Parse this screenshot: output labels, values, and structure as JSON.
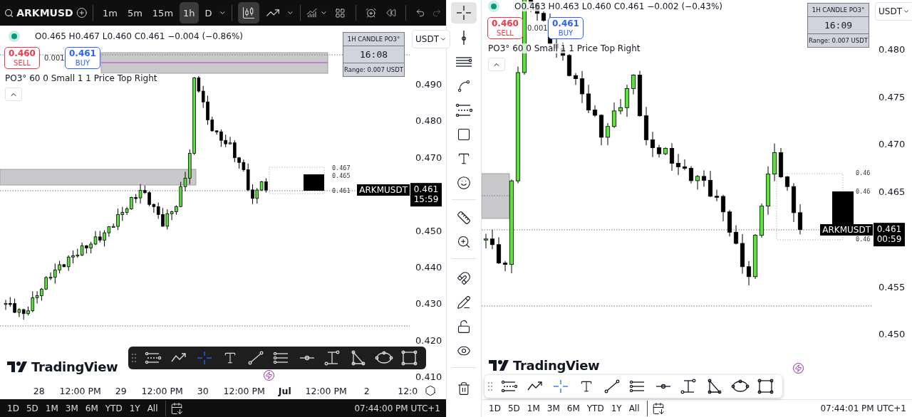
{
  "left": {
    "symbol": "ARKMUSD",
    "intervals": [
      {
        "label": "1m",
        "selected": false
      },
      {
        "label": "5m",
        "selected": false
      },
      {
        "label": "15m",
        "selected": false
      },
      {
        "label": "1h",
        "selected": true
      },
      {
        "label": "D",
        "selected": false
      }
    ],
    "chart_types": [
      {
        "kind": "candles",
        "selected": true
      },
      {
        "kind": "line",
        "selected": false
      }
    ],
    "legend": "O0.465 H0.467 L0.460 C0.461 −0.004 (−0.86%)",
    "sell": {
      "price": "0.460",
      "label": "SELL"
    },
    "spread": "0.001",
    "buy": {
      "price": "0.461",
      "label": "BUY"
    },
    "indicator": "PO3° 60 0 Small 1 1 Price Top Right",
    "candle_box": {
      "title": "1H CANDLE PO3°",
      "time": "16:08",
      "range": "Range: 0.007 USDT"
    },
    "currency": "USDT",
    "price_labels": [
      "0.490",
      "0.480",
      "0.470",
      "0.450",
      "0.440",
      "0.430",
      "0.420",
      "0.410"
    ],
    "level_labels": [
      "0.467",
      "0.465",
      "0.461"
    ],
    "last_price": {
      "symbol": "ARKMUSDT",
      "price": "0.461",
      "countdown": "15:59"
    },
    "logo": "TradingView",
    "tools": [
      {
        "kind": "fib-channel",
        "selected": false
      },
      {
        "kind": "path",
        "selected": false
      },
      {
        "kind": "crosshair",
        "selected": true
      },
      {
        "kind": "text",
        "selected": false
      },
      {
        "kind": "trend-line",
        "selected": false
      },
      {
        "kind": "parallel-channel",
        "selected": false
      },
      {
        "kind": "horizontal-ray",
        "selected": false
      },
      {
        "kind": "price-range",
        "selected": false
      },
      {
        "kind": "triangle",
        "selected": false
      },
      {
        "kind": "ellipse",
        "selected": false
      },
      {
        "kind": "rectangle",
        "selected": false
      }
    ],
    "time_labels": [
      "28",
      "12:00 PM",
      "29",
      "12:00 PM",
      "30",
      "12:00 PM",
      "Jul",
      "12:00 PM",
      "2",
      "12:0"
    ],
    "ranges": [
      "1D",
      "5D",
      "1M",
      "3M",
      "6M",
      "YTD",
      "1Y",
      "All"
    ],
    "clock": "07:44:00 PM UTC+1"
  },
  "sidebar": {
    "tools": [
      {
        "kind": "crosshair",
        "selected": true
      },
      {
        "kind": "cursor",
        "selected": false
      },
      {
        "kind": "lines",
        "selected": false
      },
      {
        "kind": "pattern",
        "selected": false
      },
      {
        "kind": "fib",
        "selected": false
      },
      {
        "kind": "rectangle",
        "selected": false
      },
      {
        "kind": "text",
        "selected": false
      },
      {
        "kind": "emoji",
        "selected": false
      },
      {
        "kind": "ruler",
        "selected": false
      },
      {
        "kind": "zoom",
        "selected": false
      },
      {
        "kind": "magnet",
        "selected": false
      },
      {
        "kind": "draw-lock",
        "selected": false
      },
      {
        "kind": "lock",
        "selected": false
      },
      {
        "kind": "eye",
        "selected": false
      },
      {
        "kind": "trash",
        "selected": false
      }
    ]
  },
  "right": {
    "legend": "O0.463 H0.463 L0.460 C0.461 −0.002 (−0.43%)",
    "sell": {
      "price": "0.460",
      "label": "SELL"
    },
    "spread": "0.001",
    "buy": {
      "price": "0.461",
      "label": "BUY"
    },
    "indicator": "PO3° 60 0 Small 1 1 Price Top Right",
    "candle_box": {
      "title": "1H CANDLE PO3°",
      "time": "16:09",
      "range": "Range: 0.007 USDT"
    },
    "currency": "USDT",
    "price_labels": [
      "0.480",
      "0.475",
      "0.470",
      "0.465",
      "0.455",
      "0.450"
    ],
    "level_labels": [
      "0.46",
      "0.46",
      "0.46"
    ],
    "last_price": {
      "symbol": "ARKMUSDT",
      "price": "0.461",
      "countdown": "00:59"
    },
    "logo": "TradingView",
    "tools": [
      {
        "kind": "fib-channel",
        "selected": false
      },
      {
        "kind": "path",
        "selected": false
      },
      {
        "kind": "crosshair",
        "selected": true
      },
      {
        "kind": "text",
        "selected": false
      },
      {
        "kind": "trend-line",
        "selected": false
      },
      {
        "kind": "parallel-channel",
        "selected": false
      },
      {
        "kind": "horizontal-ray",
        "selected": false
      },
      {
        "kind": "price-range",
        "selected": false
      },
      {
        "kind": "triangle",
        "selected": false
      },
      {
        "kind": "ellipse",
        "selected": false
      },
      {
        "kind": "rectangle",
        "selected": false
      }
    ],
    "ranges": [
      "1D",
      "5D",
      "1M",
      "3M",
      "6M",
      "YTD",
      "1Y",
      "All"
    ],
    "clock": "07:44:01 PM UTC+1"
  }
}
